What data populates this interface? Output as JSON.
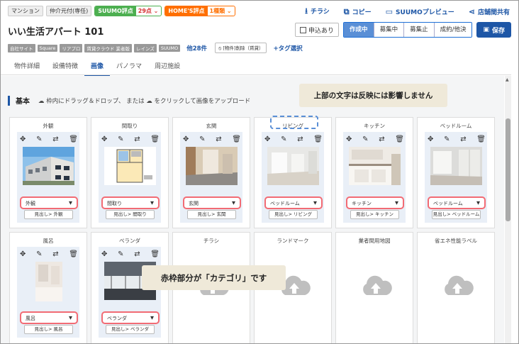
{
  "header": {
    "tags": [
      "マンション",
      "仲介元付(専任)"
    ],
    "suumo_label": "SUUMO評点",
    "suumo_value": "29点 ⌄",
    "homes_label": "HOME'S評点",
    "homes_value": "1種類 ⌄",
    "links": [
      {
        "icon": "⭳",
        "label": "チラシ"
      },
      {
        "icon": "⧉",
        "label": "コピー"
      },
      {
        "icon": "▭",
        "label": "SUUMOプレビュー"
      },
      {
        "icon": "⋖",
        "label": "店舗間共有"
      }
    ]
  },
  "property_title": "いい生活アパート 101",
  "apply_label": "申込あり",
  "status_tabs": [
    "作成中",
    "募集中",
    "募集止",
    "成約/他決"
  ],
  "save_label": "保存",
  "site_badges": [
    "自社サイト",
    "Square",
    "リアプロ",
    "賃貸クラウド 業者版",
    "レインズ",
    "SUUMO"
  ],
  "more_sites": "他28件",
  "tag_chip": "⦸ [物件]削除（賃貸）",
  "tag_select": "+タグ選択",
  "tabs": [
    "物件詳細",
    "設備特徴",
    "画像",
    "パノラマ",
    "周辺施設"
  ],
  "section": {
    "label": "基本",
    "hint": "☁ 枠内にドラッグ＆ドロップ、 または ☁ をクリックして画像をアップロード"
  },
  "callouts": {
    "top": "上部の文字は反映には影響しません",
    "middle": "赤枠部分が「カテゴリ」です"
  },
  "cards": [
    {
      "title": "外観",
      "category": "外観",
      "midashi": "見出し> 外観"
    },
    {
      "title": "間取り",
      "category": "間取り",
      "midashi": "見出し> 間取り"
    },
    {
      "title": "玄関",
      "category": "玄関",
      "midashi": "見出し> 玄関"
    },
    {
      "title": "リビング",
      "category": "ベッドルーム",
      "midashi": "見出し> リビング"
    },
    {
      "title": "キッチン",
      "category": "キッチン",
      "midashi": "見出し> キッチン"
    },
    {
      "title": "ベッドルーム",
      "category": "ベッドルーム",
      "midashi": "見出し> ベッドルーム"
    },
    {
      "title": "風呂",
      "category": "風呂",
      "midashi": "見出し> 風呂"
    },
    {
      "title": "ベランダ",
      "category": "ベランダ",
      "midashi": "見出し> ベランダ"
    }
  ],
  "empty_cards": [
    "チラシ",
    "ランドマーク",
    "業者間用地図",
    "省エネ性能ラベル"
  ],
  "icons": {
    "move": "✥",
    "edit": "✎",
    "swap": "⇄",
    "trash": "🗑",
    "arrow": "▼"
  },
  "colors": {
    "accent": "#1d56a6",
    "category_border": "#f26b74",
    "callout_bg": "#efe9d9"
  }
}
